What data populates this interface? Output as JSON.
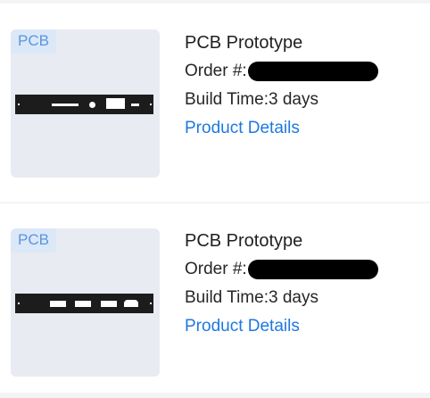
{
  "orders": [
    {
      "badge": "PCB",
      "title": "PCB Prototype",
      "order_label": "Order #:",
      "build_time": "Build Time:3 days",
      "details_link": "Product Details"
    },
    {
      "badge": "PCB",
      "title": "PCB Prototype",
      "order_label": "Order #:",
      "build_time": "Build Time:3 days",
      "details_link": "Product Details"
    }
  ],
  "colors": {
    "page_background": "#f3f4f6",
    "card_background": "#ffffff",
    "thumbnail_background": "#e8ebf1",
    "badge_background": "#dbe8f7",
    "badge_text": "#5b95e0",
    "link": "#1f78e0",
    "redaction": "#000000"
  },
  "icons": {
    "product_image": "pcb-board-icon"
  }
}
